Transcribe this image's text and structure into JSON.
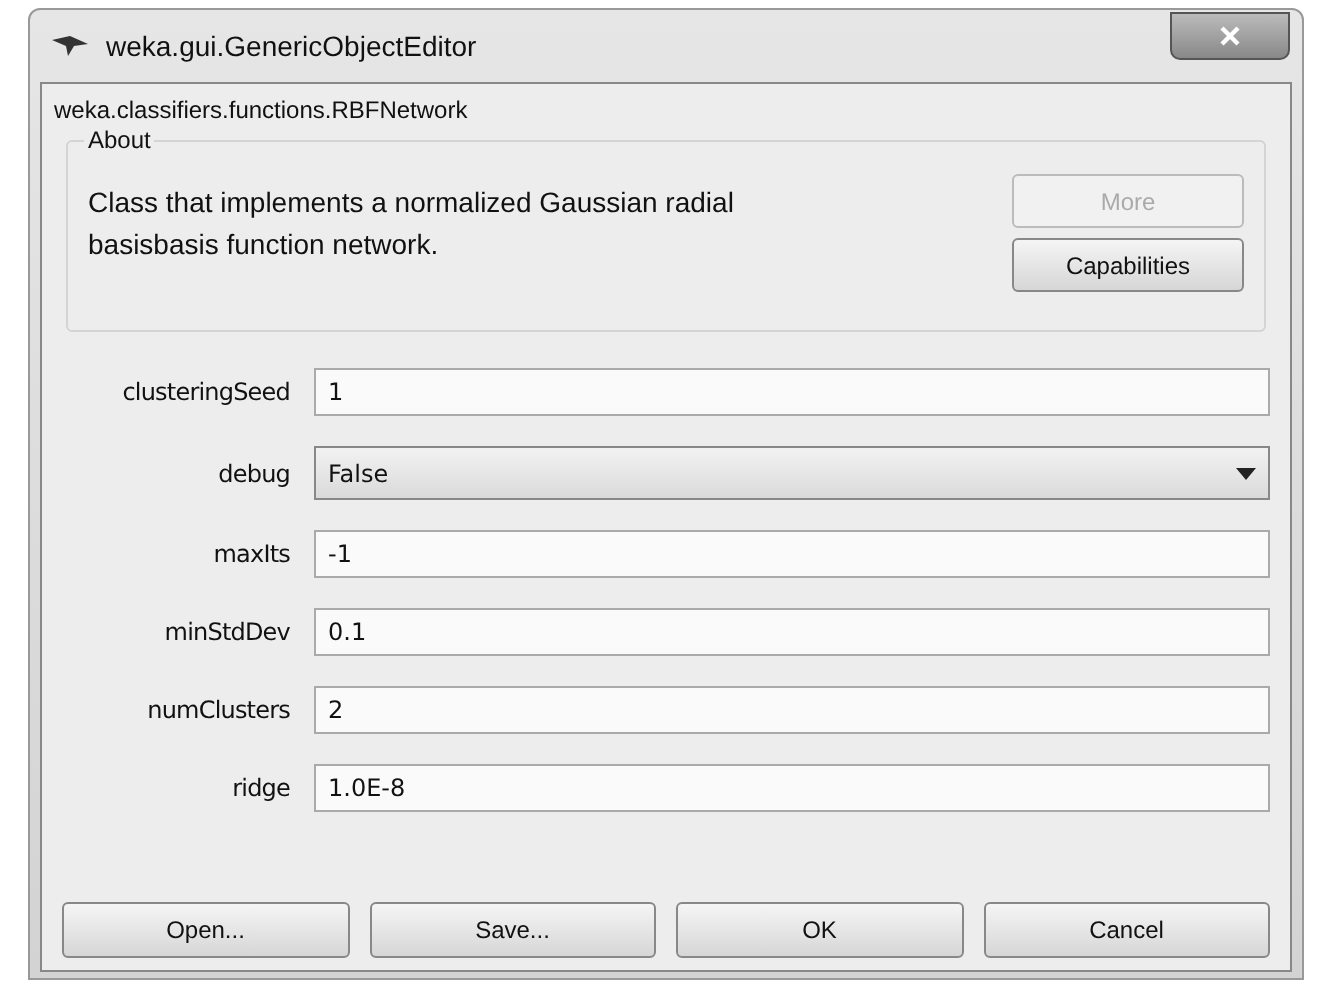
{
  "window": {
    "title": "weka.gui.GenericObjectEditor"
  },
  "class_name": "weka.classifiers.functions.RBFNetwork",
  "about": {
    "title": "About",
    "text": "Class that implements a normalized Gaussian radial basisbasis function network.",
    "buttons": [
      {
        "label": "More",
        "disabled": true
      },
      {
        "label": "Capabilities",
        "disabled": false
      }
    ]
  },
  "properties": [
    {
      "label": "clusteringSeed",
      "kind": "text",
      "value": "1"
    },
    {
      "label": "debug",
      "kind": "dropdown",
      "value": "False"
    },
    {
      "label": "maxIts",
      "kind": "text",
      "value": "-1"
    },
    {
      "label": "minStdDev",
      "kind": "text",
      "value": "0.1"
    },
    {
      "label": "numClusters",
      "kind": "text",
      "value": "2"
    },
    {
      "label": "ridge",
      "kind": "text",
      "value": "1.0E-8"
    }
  ],
  "buttons": [
    "Open...",
    "Save...",
    "OK",
    "Cancel"
  ]
}
